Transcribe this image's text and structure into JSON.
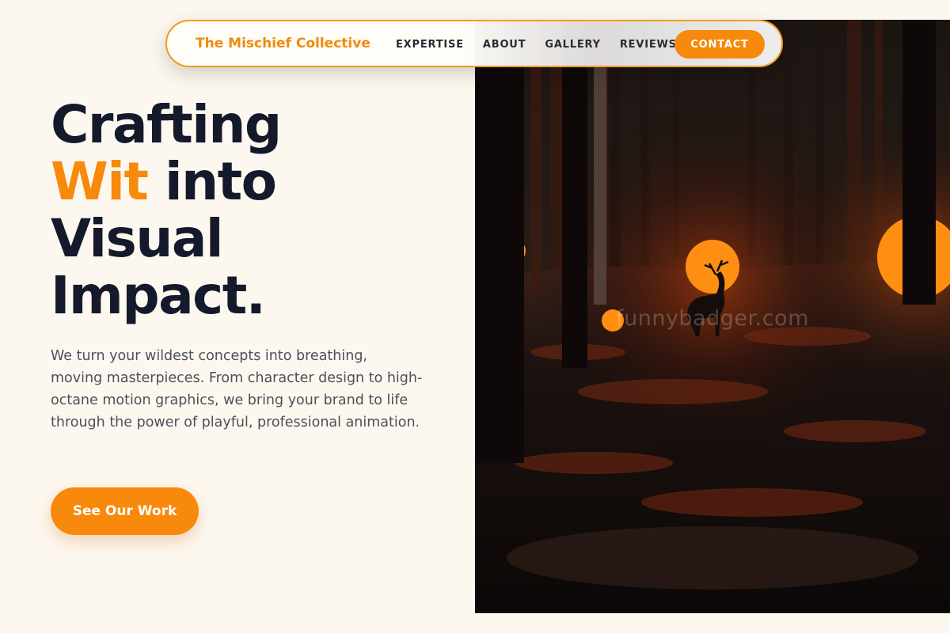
{
  "nav": {
    "brand": "The Mischief Collective",
    "links": [
      {
        "label": "EXPERTISE"
      },
      {
        "label": "ABOUT"
      },
      {
        "label": "GALLERY"
      },
      {
        "label": "REVIEWS"
      }
    ],
    "cta_label": "CONTACT"
  },
  "hero": {
    "headline_line1": "Crafting",
    "headline_accent": "Wit",
    "headline_line2_rest": " into",
    "headline_line3": "Visual",
    "headline_line4": "Impact.",
    "description": "We turn your wildest concepts into breathing, moving masterpieces. From character design to high-octane motion graphics, we bring your brand to life through the power of playful, professional animation.",
    "cta_label": "See Our Work",
    "image_watermark": "funnybadger.com"
  },
  "colors": {
    "accent": "#f7890c",
    "headline": "#141a2b",
    "background": "#fdf8ef",
    "body_text": "#4c505c"
  }
}
